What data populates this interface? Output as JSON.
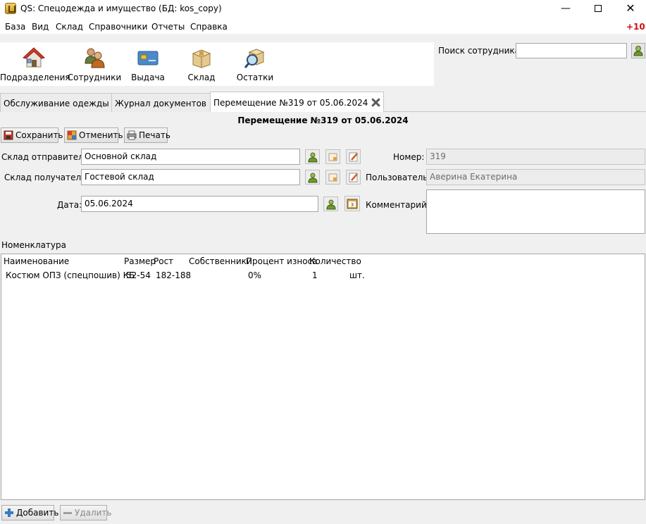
{
  "window": {
    "title": "QS: Спецодежда и имущество (БД: kos_copy)",
    "minimize": "—",
    "close": "✕"
  },
  "menu": {
    "items": [
      "База",
      "Вид",
      "Склад",
      "Справочники",
      "Отчеты",
      "Справка"
    ],
    "badge": "+10"
  },
  "toolbar": {
    "buttons": [
      {
        "label": "Подразделения",
        "icon": "house-icon"
      },
      {
        "label": "Сотрудники",
        "icon": "people-icon"
      },
      {
        "label": "Выдача",
        "icon": "card-icon"
      },
      {
        "label": "Склад",
        "icon": "box-icon"
      },
      {
        "label": "Остатки",
        "icon": "box-search-icon"
      }
    ],
    "search_label": "Поиск сотрудника:",
    "search_value": ""
  },
  "tabs": [
    {
      "label": "Обслуживание одежды",
      "active": false
    },
    {
      "label": "Журнал документов",
      "active": false
    },
    {
      "label": "Перемещение №319 от 05.06.2024",
      "active": true
    }
  ],
  "document": {
    "title": "Перемещение №319 от 05.06.2024",
    "actions": {
      "save": "Сохранить",
      "cancel": "Отменить",
      "print": "Печать"
    },
    "fields": {
      "sender_label": "Склад отправитель:",
      "sender_value": "Основной склад",
      "receiver_label": "Склад получатель:",
      "receiver_value": "Гостевой склад",
      "date_label": "Дата:",
      "date_value": "05.06.2024",
      "number_label": "Номер:",
      "number_value": "319",
      "user_label": "Пользователь:",
      "user_value": "Аверина Екатерина",
      "comment_label": "Комментарий:",
      "comment_value": ""
    },
    "nomenclature": {
      "label": "Номенклатура",
      "columns": [
        "Наименование",
        "Размер",
        "Рост",
        "Собственники",
        "Процент износа",
        "Количество"
      ],
      "rows": [
        {
          "name": "Костюм ОПЗ (спецпошив) КБ",
          "size": "52-54",
          "height": "182-188",
          "owners": "",
          "wear": "0%",
          "qty": "1",
          "unit": "шт."
        }
      ]
    },
    "bottom": {
      "add": "Добавить",
      "delete": "Удалить"
    }
  },
  "colors": {
    "accent_red": "#d01010",
    "icon_green": "#6b9a2a",
    "window_bg": "#f0f0f0"
  }
}
